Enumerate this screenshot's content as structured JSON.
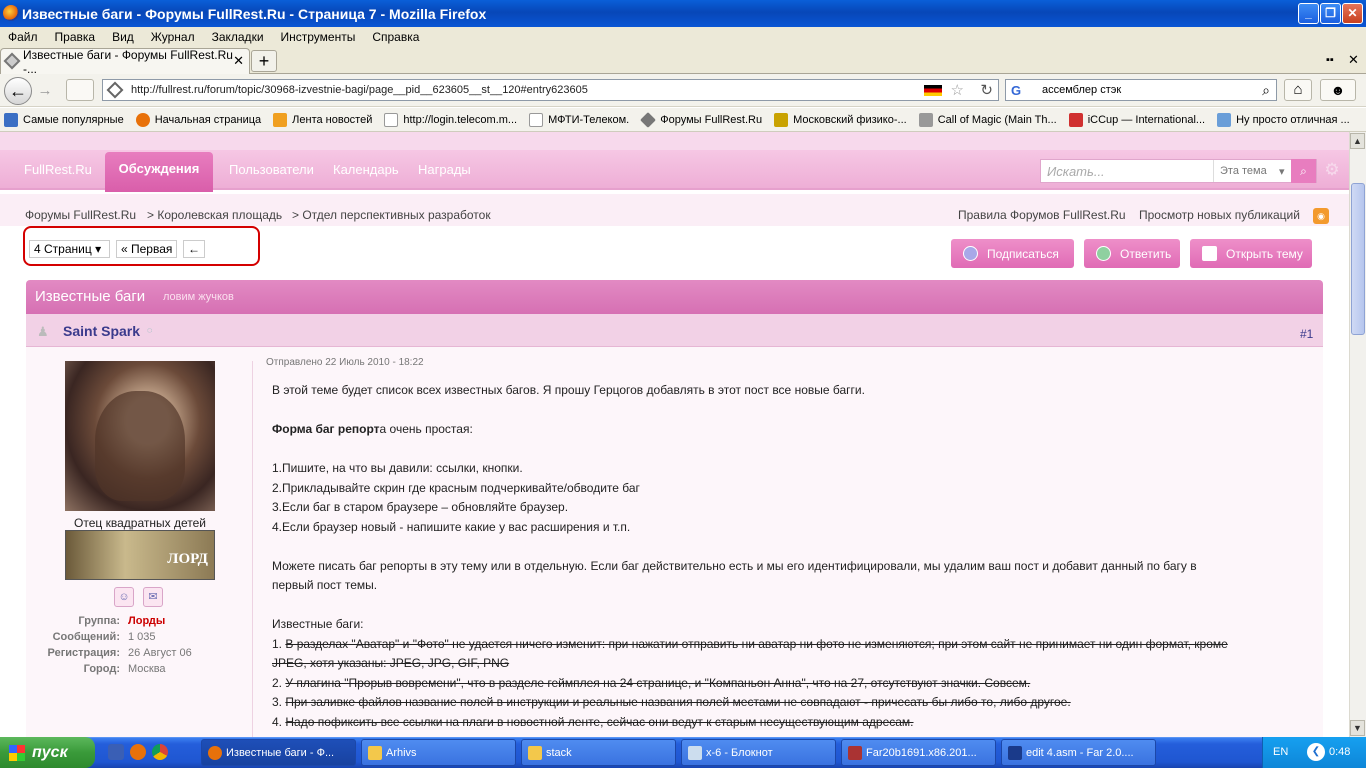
{
  "window": {
    "title": "Известные баги - Форумы FullRest.Ru - Страница 7 - Mozilla Firefox"
  },
  "menu": [
    "Файл",
    "Правка",
    "Вид",
    "Журнал",
    "Закладки",
    "Инструменты",
    "Справка"
  ],
  "tab": {
    "title": "Известные баги - Форумы FullRest.Ru -..."
  },
  "nav": {
    "url": "http://fullrest.ru/forum/topic/30968-izvestnie-bagi/page__pid__623605__st__120#entry623605",
    "search_value": "ассемблер стэк"
  },
  "bookmarks": [
    "Самые популярные",
    "Начальная страница",
    "Лента новостей",
    "http://login.telecom.m...",
    "МФТИ-Телеком.",
    "Форумы FullRest.Ru",
    "Московский физико-...",
    "Call of Magic (Main Th...",
    "iCCup — International...",
    "Ну просто отличная ..."
  ],
  "site": {
    "brand": "FullRest.Ru",
    "nav_active": "Обсуждения",
    "nav_links": [
      "Пользователи",
      "Календарь",
      "Награды"
    ],
    "search_placeholder": "Искать...",
    "search_scope": "Эта тема"
  },
  "breadcrumbs": [
    "Форумы FullRest.Ru",
    "> Королевская площадь",
    "> Отдел перспективных разработок"
  ],
  "top_links": [
    "Правила Форумов FullRest.Ru",
    "Просмотр новых публикаций"
  ],
  "pagination": {
    "pages": "4 Страниц",
    "first": "« Первая",
    "prev": "←"
  },
  "actions": {
    "subscribe": "Подписаться",
    "reply": "Ответить",
    "new_topic": "Открыть тему"
  },
  "topic": {
    "title": "Известные баги",
    "subtitle": "ловим жучков"
  },
  "post": {
    "author": "Saint Spark",
    "number": "#1",
    "user_title": "Отец квадратных детей",
    "rank_label": "ЛОРД",
    "info": [
      {
        "key": "Группа:",
        "value": "Лорды"
      },
      {
        "key": "Сообщений:",
        "value": "1 035"
      },
      {
        "key": "Регистрация:",
        "value": "26 Август 06"
      },
      {
        "key": "Город:",
        "value": "Москва"
      }
    ],
    "posted": "Отправлено 22 Июль 2010 - 18:22",
    "intro": "В этой теме будет список всех известных багов. Я прошу Герцогов добавлять в этот пост все новые багги.",
    "form_bold": "Форма баг репорт",
    "form_rest": "а очень простая:",
    "steps": [
      "1.Пишите, на что вы давили: ссылки, кнопки.",
      "2.Прикладывайте скрин где красным подчеркивайте/обводите баг",
      "3.Если баг в старом браузере – обновляйте браузер.",
      "4.Если браузер новый - напишите какие у вас расширения и т.п."
    ],
    "para1": "Можете писать баг репорты в эту тему или в отдельную. Если баг действительно есть и мы его идентифицировали, мы удалим ваш пост и добавит данный по багу в",
    "para2": "первый пост темы.",
    "known_heading": "Известные баги:",
    "bugs": [
      {
        "num": "1.",
        "text": "В разделах \"Аватар\" и \"Фото\" не удается ничего изменит: при нажатии отправить ни аватар ни фото не изменяются; при этом сайт не принимает ни один формат, кроме"
      },
      {
        "num": "",
        "text": "JPEG, хотя указаны: JPEG, JPG, GIF, PNG"
      },
      {
        "num": "2.",
        "text": "У плагина \"Прорыв вовремени\", что в разделе геймплея на 24 странице, и \"Компаньон Анна\", что на 27, отсутствуют значки. Совсем."
      },
      {
        "num": "3.",
        "text": "При заливке файлов название полей в инструкции и реальные названия полей местами не совпадают - причесать бы либо то, либо другое."
      },
      {
        "num": "4.",
        "text": "Надо пофиксить все ссылки на плаги в новостной ленте, сейчас они ведут к старым несуществующим адресам."
      }
    ]
  },
  "taskbar": {
    "start": "пуск",
    "tasks": [
      "Известные баги - Ф...",
      "Arhivs",
      "stack",
      "x-6 - Блокнот",
      "Far20b1691.x86.201...",
      "edit 4.asm - Far 2.0...."
    ],
    "lang": "EN",
    "clock": "0:48"
  },
  "colors": {
    "accent_pink": "#e87dbf",
    "xp_blue": "#245edb",
    "group_red": "#cc0000"
  }
}
